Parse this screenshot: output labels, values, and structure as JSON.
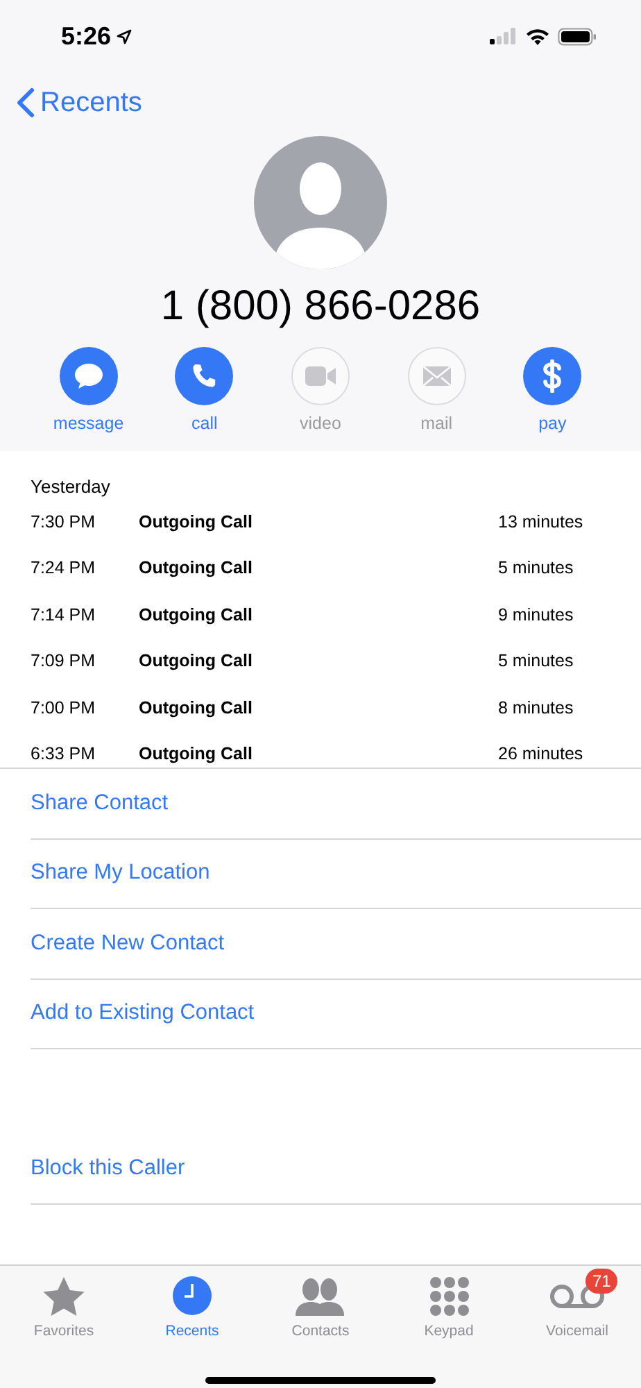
{
  "status_bar": {
    "time": "5:26"
  },
  "nav": {
    "back_label": "Recents"
  },
  "contact": {
    "number": "1 (800) 866-0286"
  },
  "actions": [
    {
      "kind": "message",
      "label": "message",
      "disabled": false
    },
    {
      "kind": "call",
      "label": "call",
      "disabled": false
    },
    {
      "kind": "video",
      "label": "video",
      "disabled": true
    },
    {
      "kind": "mail",
      "label": "mail",
      "disabled": true
    },
    {
      "kind": "pay",
      "label": "pay",
      "disabled": false
    }
  ],
  "call_log": {
    "date": "Yesterday",
    "rows": [
      {
        "time": "7:30 PM",
        "type": "Outgoing Call",
        "duration": "13 minutes"
      },
      {
        "time": "7:24 PM",
        "type": "Outgoing Call",
        "duration": "5 minutes"
      },
      {
        "time": "7:14 PM",
        "type": "Outgoing Call",
        "duration": "9 minutes"
      },
      {
        "time": "7:09 PM",
        "type": "Outgoing Call",
        "duration": "5 minutes"
      },
      {
        "time": "7:00 PM",
        "type": "Outgoing Call",
        "duration": "8 minutes"
      },
      {
        "time": "6:33 PM",
        "type": "Outgoing Call",
        "duration": "26 minutes"
      }
    ]
  },
  "links": [
    "Share Contact",
    "Share My Location",
    "Create New Contact",
    "Add to Existing Contact"
  ],
  "block_link": "Block this Caller",
  "tab_bar": [
    {
      "kind": "favorites",
      "label": "Favorites",
      "selected": false
    },
    {
      "kind": "recents",
      "label": "Recents",
      "selected": true
    },
    {
      "kind": "contacts",
      "label": "Contacts",
      "selected": false
    },
    {
      "kind": "keypad",
      "label": "Keypad",
      "selected": false
    },
    {
      "kind": "voicemail",
      "label": "Voicemail",
      "selected": false,
      "badge": "71"
    }
  ]
}
